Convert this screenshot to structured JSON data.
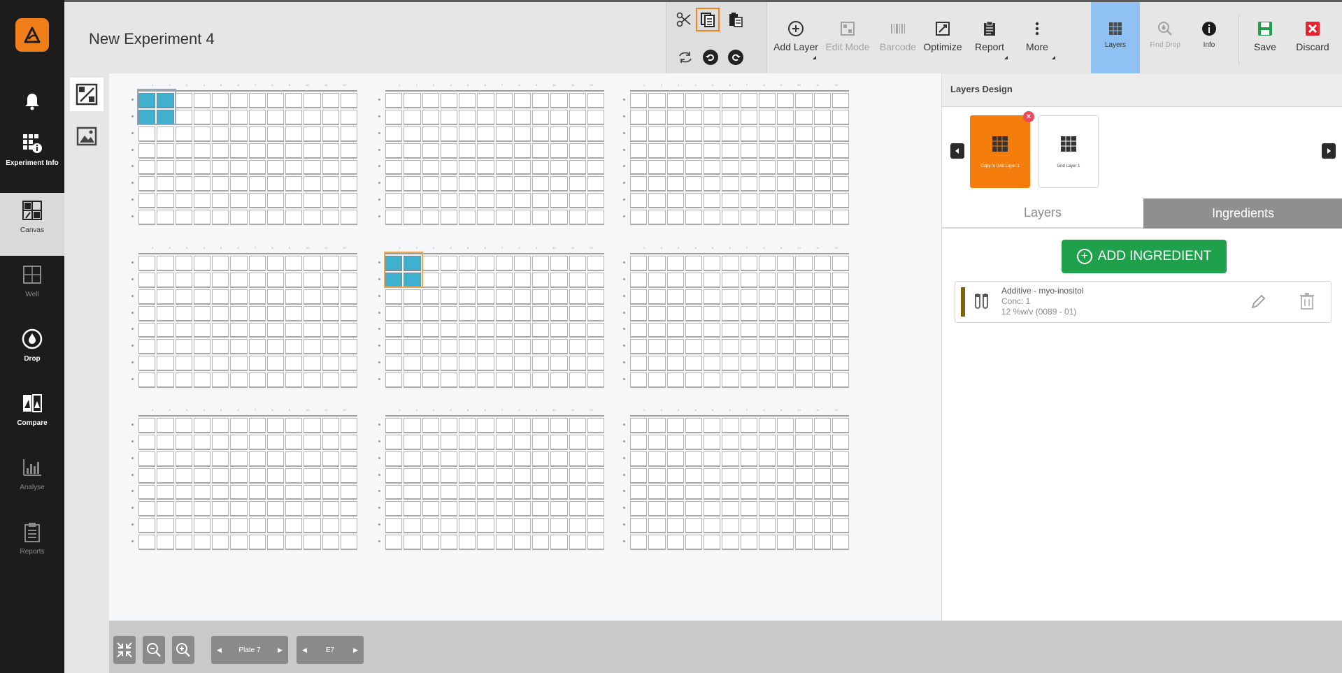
{
  "header": {
    "title": "New Experiment 4"
  },
  "sidebar": {
    "items": [
      {
        "key": "notifications",
        "label": ""
      },
      {
        "key": "experiment_info",
        "label": "Experiment Info"
      },
      {
        "key": "canvas",
        "label": "Canvas"
      },
      {
        "key": "well",
        "label": "Well"
      },
      {
        "key": "drop",
        "label": "Drop"
      },
      {
        "key": "compare",
        "label": "Compare"
      },
      {
        "key": "analyse",
        "label": "Analyse"
      },
      {
        "key": "reports",
        "label": "Reports"
      }
    ]
  },
  "toolbar": {
    "add_layer": "Add Layer",
    "edit_mode": "Edit Mode",
    "barcode": "Barcode",
    "optimize": "Optimize",
    "report": "Report",
    "more": "More",
    "layers": "Layers",
    "find_drop": "Find Drop",
    "info": "Info",
    "save": "Save",
    "discard": "Discard"
  },
  "plates": {
    "row_labels": [
      "A",
      "B",
      "C",
      "D",
      "E",
      "F",
      "G",
      "H"
    ],
    "col_labels": [
      "1",
      "2",
      "3",
      "4",
      "5",
      "6",
      "7",
      "8",
      "9",
      "10",
      "11",
      "12"
    ]
  },
  "bottom_bar": {
    "plate_nav": "Plate 7",
    "well_nav": "E7"
  },
  "right_panel": {
    "title": "Layers Design",
    "layer_cards": [
      {
        "label": "Copy fo Grid Layer 1",
        "active": true
      },
      {
        "label": "Grid Layer 1",
        "active": false
      }
    ],
    "tabs": {
      "layers": "Layers",
      "ingredients": "Ingredients"
    },
    "add_ingredient": "ADD INGREDIENT",
    "ingredients": [
      {
        "name": "Additive - myo-inositol",
        "conc": "Conc: 1",
        "detail": "12 %w/v (0089 - 01)",
        "color": "#7a6410"
      }
    ]
  },
  "colors": {
    "accent_orange": "#f57d0c",
    "layers_active_blue": "#8fc1f3",
    "add_green": "#1fa14c",
    "selected_well": "#3fb1cf",
    "discard_red": "#e8222f",
    "save_green": "#1fa14c"
  }
}
